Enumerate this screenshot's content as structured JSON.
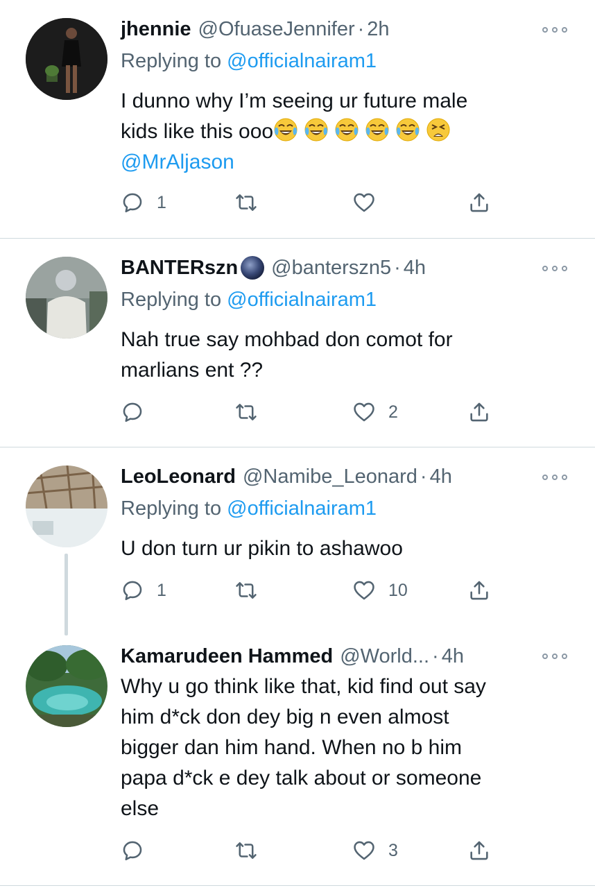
{
  "tweets": [
    {
      "name": "jhennie",
      "handle": "@OfuaseJennifer",
      "dot": "·",
      "time": "2h",
      "replying_prefix": "Replying to ",
      "replying_to": "@officialnairam1",
      "text_line1": "I dunno why I’m seeing ur future male",
      "text_line2": "kids like this ooo",
      "emojis": [
        "face-with-tears-of-joy",
        "face-with-tears-of-joy",
        "face-with-tears-of-joy",
        "face-with-tears-of-joy",
        "face-with-tears-of-joy",
        "tired-face"
      ],
      "mention": "@MrAljason",
      "replies": "1",
      "retweets": "",
      "likes": ""
    },
    {
      "name": "BANTERszn",
      "name_badge_icon": "new-moon-icon",
      "handle": "@banterszn5",
      "dot": "·",
      "time": "4h",
      "replying_prefix": "Replying to ",
      "replying_to": "@officialnairam1",
      "text_line1": "Nah true say mohbad don comot for",
      "text_line2": "marlians ent ??",
      "replies": "",
      "retweets": "",
      "likes": "2"
    },
    {
      "name": "LeoLeonard",
      "handle": "@Namibe_Leonard",
      "dot": "·",
      "time": "4h",
      "replying_prefix": "Replying to ",
      "replying_to": "@officialnairam1",
      "text_line1": "U don turn ur pikin to ashawoo",
      "replies": "1",
      "retweets": "",
      "likes": "10"
    },
    {
      "name": "Kamarudeen Hammed",
      "handle": "@World...",
      "dot": "·",
      "time": "4h",
      "text_line1": "Why u go think like that, kid find out say",
      "text_line2": "him d*ck don dey big n even almost",
      "text_line3": "bigger dan him hand. When no b him",
      "text_line4": "papa d*ck e dey talk about or someone",
      "text_line5": "else",
      "replies": "",
      "retweets": "",
      "likes": "3"
    }
  ],
  "colors": {
    "link": "#1d9bf0",
    "secondary_text": "#536471",
    "primary_text": "#0f1419",
    "divider": "#cfd9de"
  }
}
